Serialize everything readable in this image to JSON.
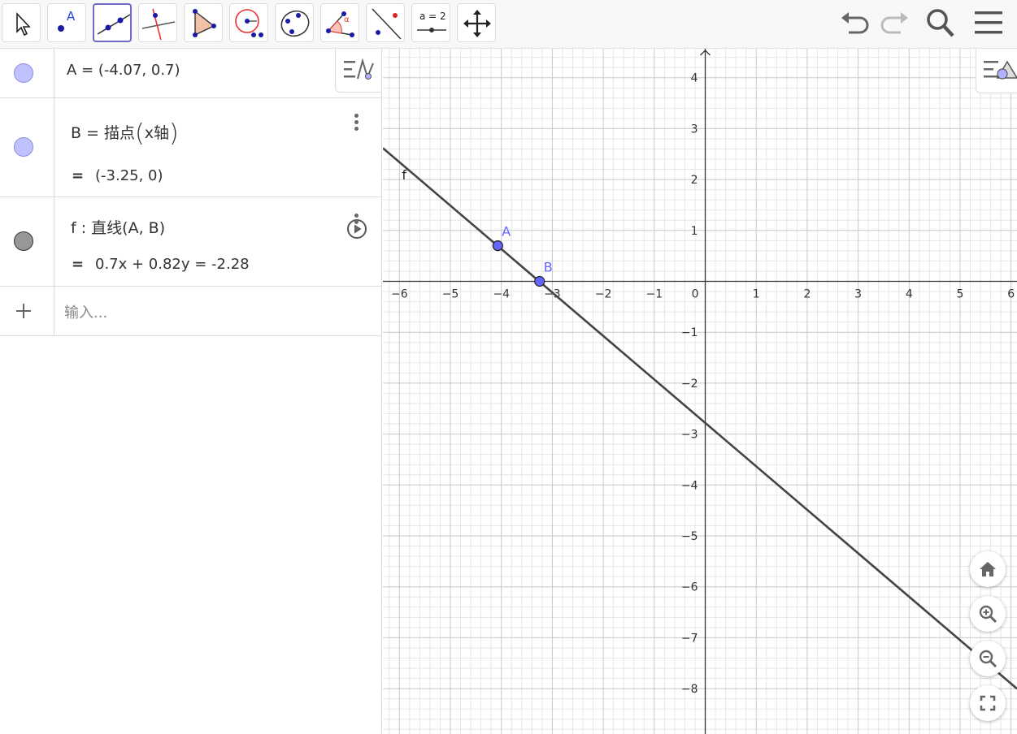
{
  "toolbar": {
    "tools": [
      {
        "name": "move-tool",
        "selected": false
      },
      {
        "name": "point-tool",
        "label": "A",
        "selected": false
      },
      {
        "name": "line-tool",
        "selected": true
      },
      {
        "name": "perpendicular-line-tool",
        "selected": false
      },
      {
        "name": "polygon-tool",
        "selected": false
      },
      {
        "name": "circle-with-center-tool",
        "selected": false
      },
      {
        "name": "circle-through-three-points-tool",
        "selected": false
      },
      {
        "name": "angle-tool",
        "label": "α",
        "selected": false
      },
      {
        "name": "reflect-about-line-tool",
        "selected": false
      },
      {
        "name": "slider-tool",
        "label": "a = 2",
        "selected": false
      },
      {
        "name": "move-graphics-view-tool",
        "selected": false
      }
    ],
    "icons": [
      "undo-icon",
      "redo-icon",
      "search-icon",
      "menu-icon"
    ]
  },
  "algebra": {
    "rows": [
      {
        "marble": "light",
        "text": "A = (-4.07, 0.7)"
      },
      {
        "marble": "light",
        "definition_prefix": "B = 描点",
        "definition_arg": "x轴",
        "value_eq": "=",
        "value": "(-3.25, 0)"
      },
      {
        "marble": "gray",
        "definition": "f : 直线(A, B)",
        "value_eq": "=",
        "value": "0.7x + 0.82y = -2.28"
      }
    ],
    "input_placeholder": "输入..."
  },
  "graphics": {
    "x_ticks": [
      "−6",
      "−5",
      "−4",
      "−3",
      "−2",
      "−1",
      "0",
      "1",
      "2",
      "3",
      "4",
      "5",
      "6"
    ],
    "y_ticks": [
      "4",
      "3",
      "2",
      "1",
      "−1",
      "−2",
      "−3",
      "−4",
      "−5",
      "−6",
      "−7",
      "−8"
    ],
    "points": [
      {
        "label": "A",
        "x": -4.07,
        "y": 0.7
      },
      {
        "label": "B",
        "x": -3.25,
        "y": 0
      }
    ],
    "line": {
      "label": "f",
      "a": 0.7,
      "b": 0.82,
      "c": -2.28
    },
    "colors": {
      "point_fill": "#6464ff",
      "point_label": "#6464ff",
      "line": "#444444",
      "grid_minor": "#e6e6e6",
      "grid_major": "#c8c8c8"
    }
  }
}
